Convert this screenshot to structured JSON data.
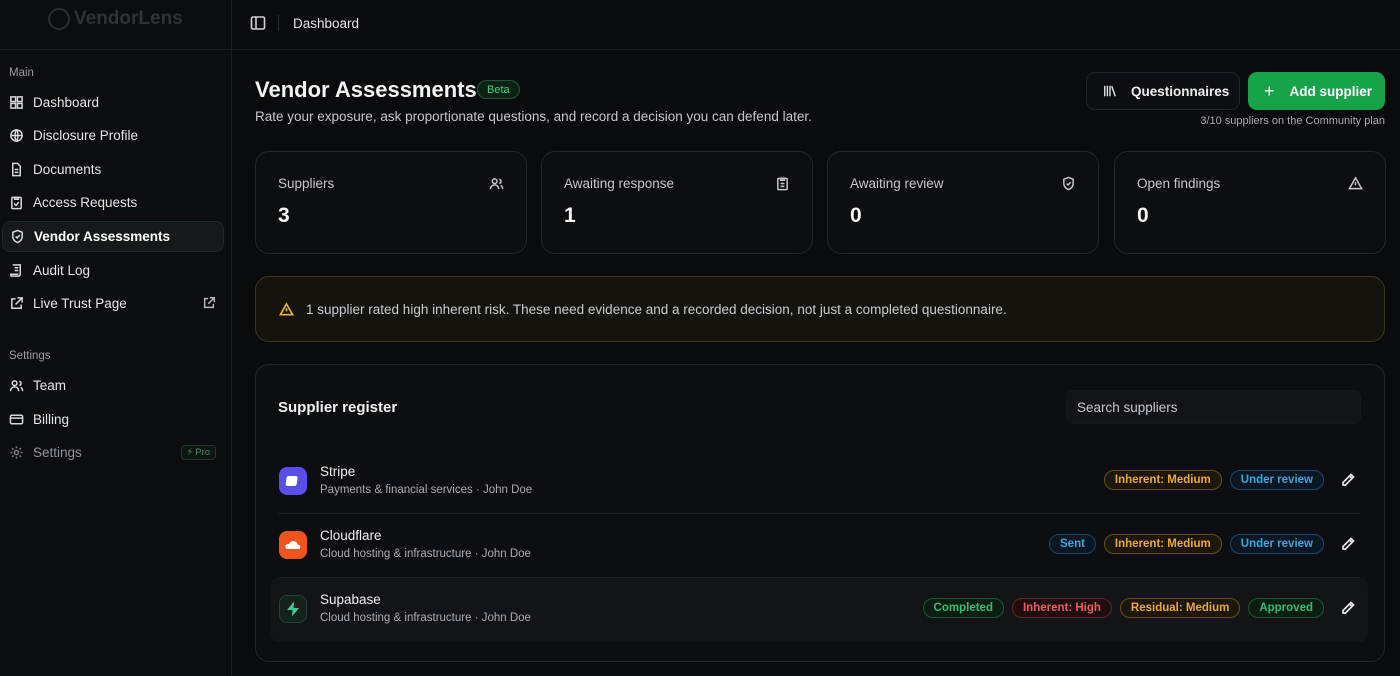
{
  "app": {
    "name": "VendorLens"
  },
  "sidebar": {
    "main_label": "Main",
    "items": [
      {
        "label": "Dashboard",
        "icon": "grid-icon"
      },
      {
        "label": "Disclosure Profile",
        "icon": "globe-icon"
      },
      {
        "label": "Documents",
        "icon": "file-icon"
      },
      {
        "label": "Access Requests",
        "icon": "clipboard-check-icon"
      },
      {
        "label": "Vendor Assessments",
        "icon": "shield-icon",
        "active": true
      },
      {
        "label": "Audit Log",
        "icon": "scroll-icon"
      },
      {
        "label": "Live Trust Page",
        "icon": "external-link-icon"
      }
    ],
    "settings_label": "Settings",
    "settings_items": [
      {
        "label": "Team",
        "icon": "users-icon"
      },
      {
        "label": "Billing",
        "icon": "credit-card-icon"
      },
      {
        "label": "Settings",
        "icon": "gear-icon",
        "badge": "Pro"
      }
    ]
  },
  "topbar": {
    "breadcrumb": "Dashboard"
  },
  "header": {
    "title": "Vendor Assessments",
    "badge": "Beta",
    "subtitle": "Rate your exposure, ask proportionate questions, and record a decision you can defend later.",
    "questionnaires_label": "Questionnaires",
    "add_label": "Add supplier",
    "plan_note": "3/10 suppliers on the Community plan"
  },
  "stats": [
    {
      "label": "Suppliers",
      "value": "3",
      "icon": "users-icon"
    },
    {
      "label": "Awaiting response",
      "value": "1",
      "icon": "clipboard-icon"
    },
    {
      "label": "Awaiting review",
      "value": "0",
      "icon": "shield-check-icon"
    },
    {
      "label": "Open findings",
      "value": "0",
      "icon": "warning-icon"
    }
  ],
  "alert": {
    "text": "1 supplier rated high inherent risk. These need evidence and a recorded decision, not just a completed questionnaire."
  },
  "register": {
    "title": "Supplier register",
    "search_placeholder": "Search suppliers",
    "rows": [
      {
        "name": "Stripe",
        "meta": "Payments & financial services · John Doe",
        "badges": [
          {
            "text": "Inherent: Medium",
            "tone": "amber"
          },
          {
            "text": "Under review",
            "tone": "blue"
          }
        ]
      },
      {
        "name": "Cloudflare",
        "meta": "Cloud hosting & infrastructure · John Doe",
        "badges": [
          {
            "text": "Sent",
            "tone": "blue"
          },
          {
            "text": "Inherent: Medium",
            "tone": "amber"
          },
          {
            "text": "Under review",
            "tone": "blue"
          }
        ]
      },
      {
        "name": "Supabase",
        "meta": "Cloud hosting & infrastructure · John Doe",
        "badges": [
          {
            "text": "Completed",
            "tone": "green"
          },
          {
            "text": "Inherent: High",
            "tone": "red"
          },
          {
            "text": "Residual: Medium",
            "tone": "amber"
          },
          {
            "text": "Approved",
            "tone": "green"
          }
        ]
      }
    ]
  },
  "colors": {
    "accent": "#16a34a",
    "background": "#0a0b0d",
    "warning": "#e8b23a"
  }
}
